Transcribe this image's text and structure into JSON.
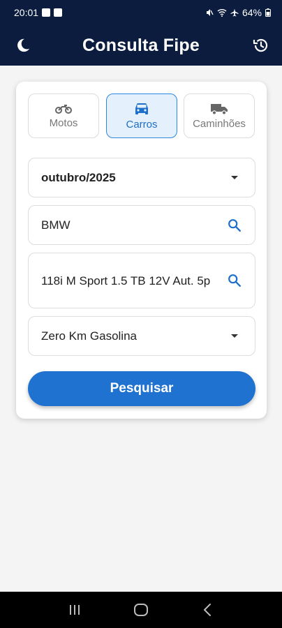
{
  "status_bar": {
    "time": "20:01",
    "battery": "64%"
  },
  "app_bar": {
    "title": "Consulta Fipe",
    "theme_icon": "moon-icon",
    "history_icon": "history-icon"
  },
  "vehicle_types": [
    {
      "label": "Motos",
      "icon": "motorcycle-icon",
      "selected": false
    },
    {
      "label": "Carros",
      "icon": "car-icon",
      "selected": true
    },
    {
      "label": "Caminhões",
      "icon": "truck-icon",
      "selected": false
    }
  ],
  "form": {
    "reference_month": "outubro/2025",
    "brand": "BMW",
    "model": "118i M Sport 1.5 TB 12V Aut. 5p",
    "year": "Zero Km Gasolina",
    "submit_label": "Pesquisar"
  },
  "colors": {
    "header": "#0b1c3e",
    "accent": "#1f72cf",
    "selected_bg": "#e4f0fc"
  }
}
